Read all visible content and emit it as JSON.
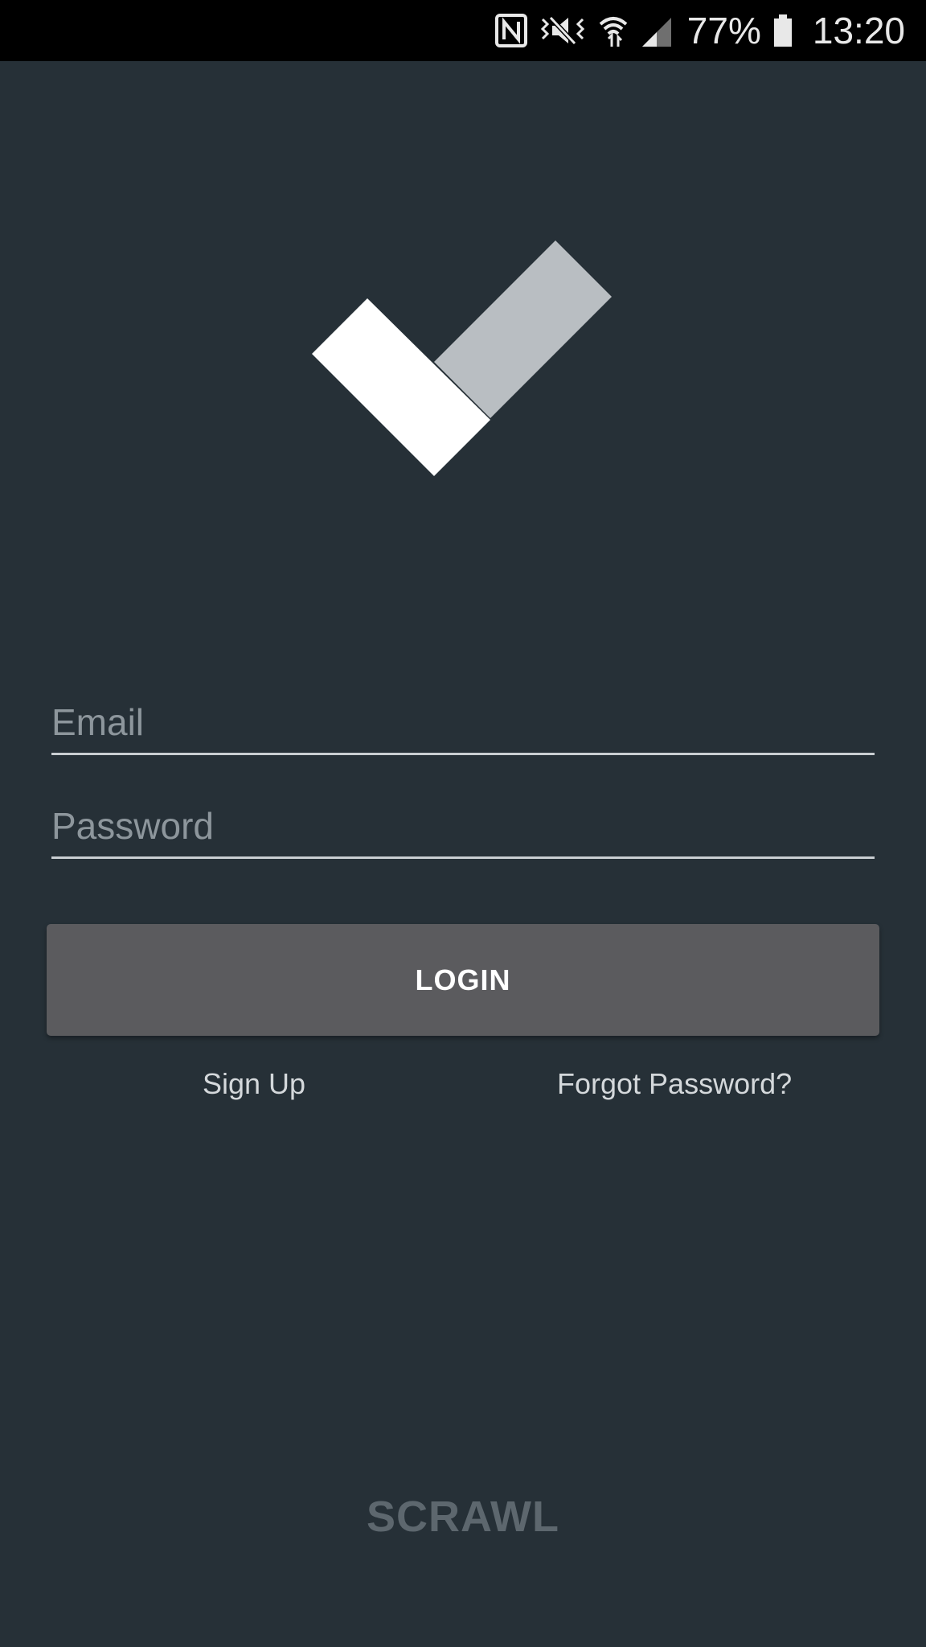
{
  "status_bar": {
    "battery_percent": "77%",
    "time": "13:20",
    "icons": [
      "nfc-icon",
      "vibrate-icon",
      "wifi-icon",
      "signal-icon",
      "battery-icon"
    ]
  },
  "login_form": {
    "email_placeholder": "Email",
    "email_value": "",
    "password_placeholder": "Password",
    "password_value": "",
    "login_label": "LOGIN",
    "signup_label": "Sign Up",
    "forgot_label": "Forgot Password?"
  },
  "brand": {
    "name": "SCRAWL"
  },
  "colors": {
    "background": "#263037",
    "button": "#5b5b5e",
    "logo_primary": "#ffffff",
    "logo_secondary": "#b9bec2",
    "brand_text": "#5d676e"
  }
}
